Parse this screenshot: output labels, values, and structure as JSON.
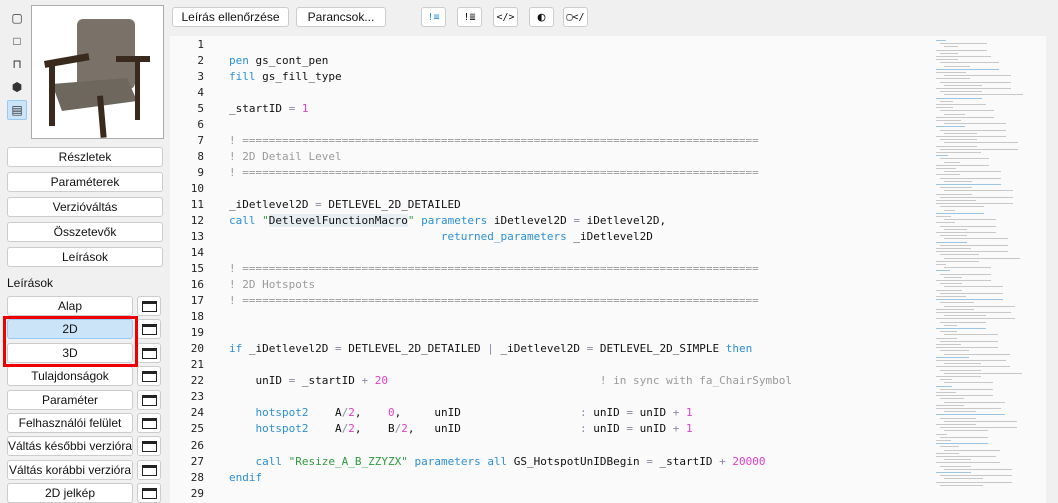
{
  "sidebar_icons": [
    "view-2d-icon",
    "view-3d-icon",
    "floor-plan-icon",
    "cube-icon",
    "script-list-icon"
  ],
  "nav_buttons": [
    "Részletek",
    "Paraméterek",
    "Verzióváltás",
    "Összetevők",
    "Leírások"
  ],
  "scripts_heading": "Leírások",
  "script_buttons": [
    "Alap",
    "2D",
    "3D",
    "Tulajdonságok",
    "Paraméter",
    "Felhasználói felület",
    "Váltás későbbi verzióra",
    "Váltás korábbi verzióra",
    "2D jelkép"
  ],
  "selected_script": "2D",
  "toolbar": {
    "check_label": "Leírás ellenőrzése",
    "commands_label": "Parancsok...",
    "icons": [
      "warning-list-icon",
      "warning-list-bold-icon",
      "code-format-icon",
      "theme-contrast-icon",
      "code-window-icon"
    ]
  },
  "code_lines": [
    [],
    [
      [
        "kw",
        "pen"
      ],
      [
        "t",
        " gs_cont_pen"
      ]
    ],
    [
      [
        "kw",
        "fill"
      ],
      [
        "t",
        " gs_fill_type"
      ]
    ],
    [],
    [
      [
        "t",
        "_startID "
      ],
      [
        "op",
        "="
      ],
      [
        "t",
        " "
      ],
      [
        "num",
        "1"
      ]
    ],
    [],
    [
      [
        "cmt",
        "! =============================================================================="
      ]
    ],
    [
      [
        "cmt",
        "! 2D Detail Level"
      ]
    ],
    [
      [
        "cmt",
        "! =============================================================================="
      ]
    ],
    [],
    [
      [
        "t",
        "_iDetlevel2D "
      ],
      [
        "op",
        "="
      ],
      [
        "t",
        " DETLEVEL_2D_DETAILED"
      ]
    ],
    [
      [
        "kw",
        "call"
      ],
      [
        "t",
        " "
      ],
      [
        "str",
        "\""
      ],
      [
        "hl",
        "DetlevelFunctionMacro"
      ],
      [
        "str",
        "\""
      ],
      [
        "t",
        " "
      ],
      [
        "kw",
        "parameters"
      ],
      [
        "t",
        " iDetlevel2D "
      ],
      [
        "op",
        "="
      ],
      [
        "t",
        " iDetlevel2D,"
      ]
    ],
    [
      [
        "t",
        "                                "
      ],
      [
        "kw",
        "returned_parameters"
      ],
      [
        "t",
        " _iDetlevel2D"
      ]
    ],
    [],
    [
      [
        "cmt",
        "! =============================================================================="
      ]
    ],
    [
      [
        "cmt",
        "! 2D Hotspots"
      ]
    ],
    [
      [
        "cmt",
        "! =============================================================================="
      ]
    ],
    [],
    [],
    [
      [
        "kw",
        "if"
      ],
      [
        "t",
        " _iDetlevel2D "
      ],
      [
        "op",
        "="
      ],
      [
        "t",
        " DETLEVEL_2D_DETAILED "
      ],
      [
        "op",
        "|"
      ],
      [
        "t",
        " _iDetlevel2D "
      ],
      [
        "op",
        "="
      ],
      [
        "t",
        " DETLEVEL_2D_SIMPLE "
      ],
      [
        "kw",
        "then"
      ]
    ],
    [],
    [
      [
        "t",
        "    unID "
      ],
      [
        "op",
        "="
      ],
      [
        "t",
        " _startID "
      ],
      [
        "op",
        "+"
      ],
      [
        "t",
        " "
      ],
      [
        "num",
        "20"
      ],
      [
        "t",
        "                                "
      ],
      [
        "cmt",
        "! in sync with fa_ChairSymbol"
      ]
    ],
    [],
    [
      [
        "t",
        "    "
      ],
      [
        "kw",
        "hotspot2"
      ],
      [
        "t",
        "    A"
      ],
      [
        "op",
        "/"
      ],
      [
        "num",
        "2"
      ],
      [
        "t",
        ",    "
      ],
      [
        "num",
        "0"
      ],
      [
        "t",
        ",     unID                  "
      ],
      [
        "op",
        ":"
      ],
      [
        "t",
        " unID "
      ],
      [
        "op",
        "="
      ],
      [
        "t",
        " unID "
      ],
      [
        "op",
        "+"
      ],
      [
        "t",
        " "
      ],
      [
        "num",
        "1"
      ]
    ],
    [
      [
        "t",
        "    "
      ],
      [
        "kw",
        "hotspot2"
      ],
      [
        "t",
        "    A"
      ],
      [
        "op",
        "/"
      ],
      [
        "num",
        "2"
      ],
      [
        "t",
        ",    B"
      ],
      [
        "op",
        "/"
      ],
      [
        "num",
        "2"
      ],
      [
        "t",
        ",   unID                  "
      ],
      [
        "op",
        ":"
      ],
      [
        "t",
        " unID "
      ],
      [
        "op",
        "="
      ],
      [
        "t",
        " unID "
      ],
      [
        "op",
        "+"
      ],
      [
        "t",
        " "
      ],
      [
        "num",
        "1"
      ]
    ],
    [],
    [
      [
        "t",
        "    "
      ],
      [
        "kw",
        "call"
      ],
      [
        "t",
        " "
      ],
      [
        "str",
        "\"Resize_A_B_ZZYZX\""
      ],
      [
        "t",
        " "
      ],
      [
        "kw",
        "parameters all"
      ],
      [
        "t",
        " GS_HotspotUnIDBegin "
      ],
      [
        "op",
        "="
      ],
      [
        "t",
        " _startID "
      ],
      [
        "op",
        "+"
      ],
      [
        "t",
        " "
      ],
      [
        "num",
        "20000"
      ]
    ],
    [
      [
        "kw",
        "endif"
      ]
    ],
    []
  ]
}
